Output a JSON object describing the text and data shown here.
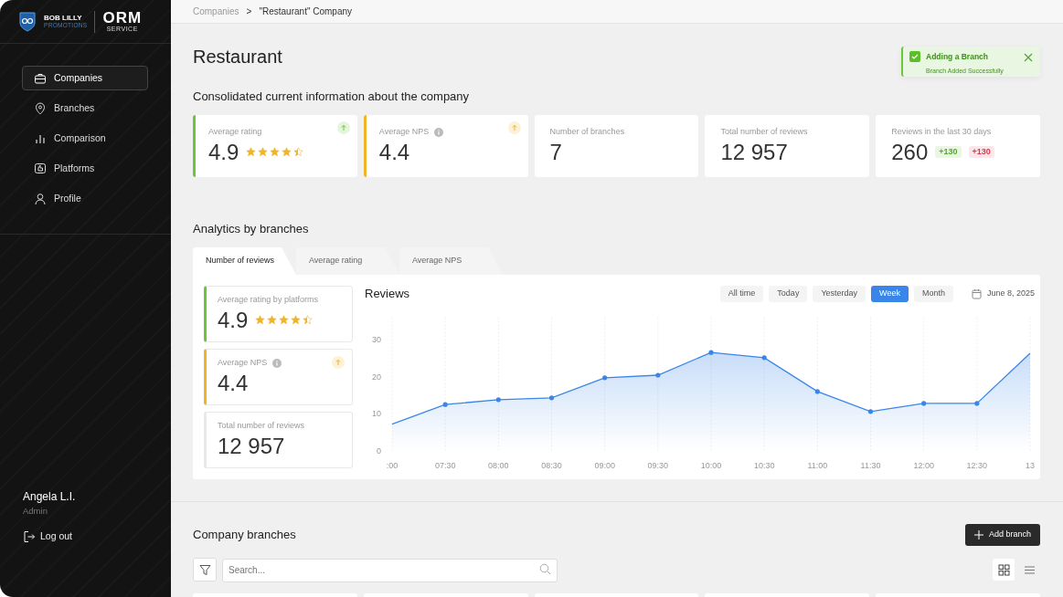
{
  "sidebar": {
    "logo": {
      "brand": "BOB LILLY",
      "brand_sub": "PROMOTIONS",
      "product": "ORM",
      "product_sub": "SERVICE"
    },
    "items": [
      {
        "label": "Companies",
        "selected": true
      },
      {
        "label": "Branches",
        "selected": false
      },
      {
        "label": "Comparison",
        "selected": false
      },
      {
        "label": "Platforms",
        "selected": false
      },
      {
        "label": "Profile",
        "selected": false
      }
    ],
    "user": {
      "name": "Angela L.I.",
      "role": "Admin"
    },
    "logout": "Log out"
  },
  "breadcrumb": {
    "items": [
      "Companies",
      "\"Restaurant\" Company"
    ],
    "separator": ">"
  },
  "toast": {
    "title": "Adding a Branch",
    "message": "Branch Added Successfully"
  },
  "page_title": "Restaurant",
  "summary": {
    "heading": "Consolidated current information about the company",
    "cards": [
      {
        "label": "Average rating",
        "value": "4.9",
        "stars": 4.5,
        "color": "#6cc63a",
        "trend_up": true
      },
      {
        "label": "Average NPS",
        "value": "4.4",
        "info": true,
        "color": "#f0b429",
        "trend_up": true
      },
      {
        "label": "Number of branches",
        "value": "7"
      },
      {
        "label": "Total number of reviews",
        "value": "12 957"
      },
      {
        "label": "Reviews in the last 30 days",
        "value": "260",
        "deltas": [
          {
            "text": "+130",
            "color": "#4caf22"
          },
          {
            "text": "+130",
            "color": "#e0344b"
          }
        ]
      }
    ]
  },
  "analytics": {
    "heading": "Analytics by branches",
    "tabs": [
      {
        "label": "Number of reviews",
        "selected": true
      },
      {
        "label": "Average rating",
        "selected": false
      },
      {
        "label": "Average NPS",
        "selected": false
      }
    ],
    "cards": [
      {
        "label": "Average rating by platforms",
        "value": "4.9",
        "stars": 4.5,
        "color": "#6cc63a"
      },
      {
        "label": "Average NPS",
        "value": "4.4",
        "info": true,
        "color": "#f0b429",
        "trend_up": true
      },
      {
        "label": "Total number of reviews",
        "value": "12 957"
      }
    ],
    "periods": [
      {
        "label": "All time",
        "selected": false
      },
      {
        "label": "Today",
        "selected": false
      },
      {
        "label": "Yesterday",
        "selected": false
      },
      {
        "label": "Week",
        "selected": true
      },
      {
        "label": "Month",
        "selected": false
      }
    ],
    "date": "June 8, 2025",
    "chart_data": {
      "type": "area",
      "title": "Reviews",
      "categories": [
        ":00",
        "07:30",
        "08:00",
        "08:30",
        "09:00",
        "09:30",
        "10:00",
        "10:30",
        "11:00",
        "11:30",
        "12:00",
        "12:30",
        "13"
      ],
      "series": [
        {
          "color": "#3a86e8",
          "values": [
            7.2,
            12.5,
            13.8,
            14.3,
            19.7,
            20.4,
            26.5,
            25.1,
            16,
            10.6,
            12.8,
            12.8,
            26.3
          ]
        }
      ],
      "grid": true,
      "ylim": [
        0,
        36
      ],
      "yticks": [
        0,
        10,
        20,
        30
      ]
    }
  },
  "branches": {
    "heading": "Company branches",
    "add_button": "Add branch",
    "search": {
      "placeholder": "Search..."
    },
    "views": [
      {
        "selected": true
      },
      {
        "selected": false
      }
    ],
    "cards": [
      {
        "kind": "placeholder"
      },
      {
        "kind": "placeholder"
      },
      {
        "kind": "placeholder"
      },
      {
        "kind": "placeholder"
      },
      {
        "kind": "placeholder"
      }
    ]
  }
}
